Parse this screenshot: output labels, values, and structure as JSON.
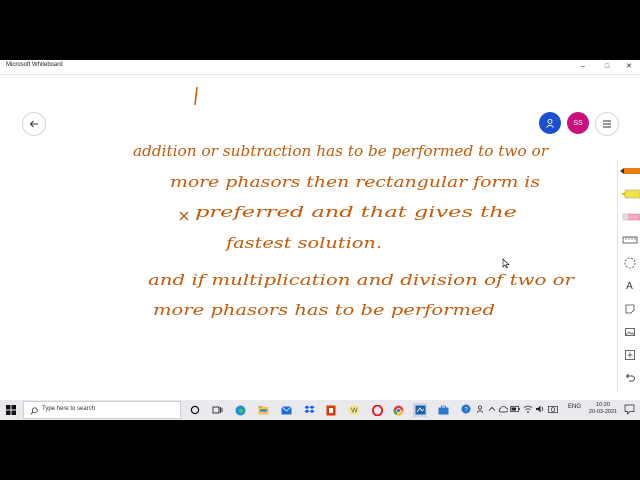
{
  "window": {
    "title": "Microsoft Whiteboard",
    "controls": [
      "–",
      "□",
      "✕"
    ]
  },
  "header": {
    "avatars": [
      {
        "label": "",
        "color": "#1a4fcf",
        "icon": "person-icon"
      },
      {
        "label": "SS",
        "color": "#c8117d"
      }
    ],
    "back_icon": "back-arrow-icon",
    "menu_icon": "hamburger-menu-icon"
  },
  "ink_lines": [
    "addition or subtraction has to be performed to two or",
    "more phasors then rectangular form is",
    "preferred and that gives the",
    "fastest solution.",
    "and if multiplication and division of two or",
    "more phasors has to be performed"
  ],
  "ink_color": "#c45a0a",
  "toolbar": {
    "tools": [
      "pen-orange-icon",
      "highlighter-yellow-icon",
      "eraser-icon",
      "ruler-icon",
      "lasso-icon",
      "text-icon",
      "note-icon",
      "image-icon",
      "add-icon",
      "undo-icon"
    ]
  },
  "taskbar": {
    "search_placeholder": "Type here to search",
    "apps": [
      "cortana-icon",
      "task-view-icon",
      "edge-icon",
      "file-explorer-icon",
      "mail-icon",
      "dropbox-icon",
      "office-icon",
      "whiteboard-w-icon",
      "opera-icon",
      "chrome-icon",
      "whiteboard-app-icon",
      "store-icon"
    ],
    "tray_language": "ENG",
    "time": "10:20",
    "date": "20-03-2021"
  }
}
